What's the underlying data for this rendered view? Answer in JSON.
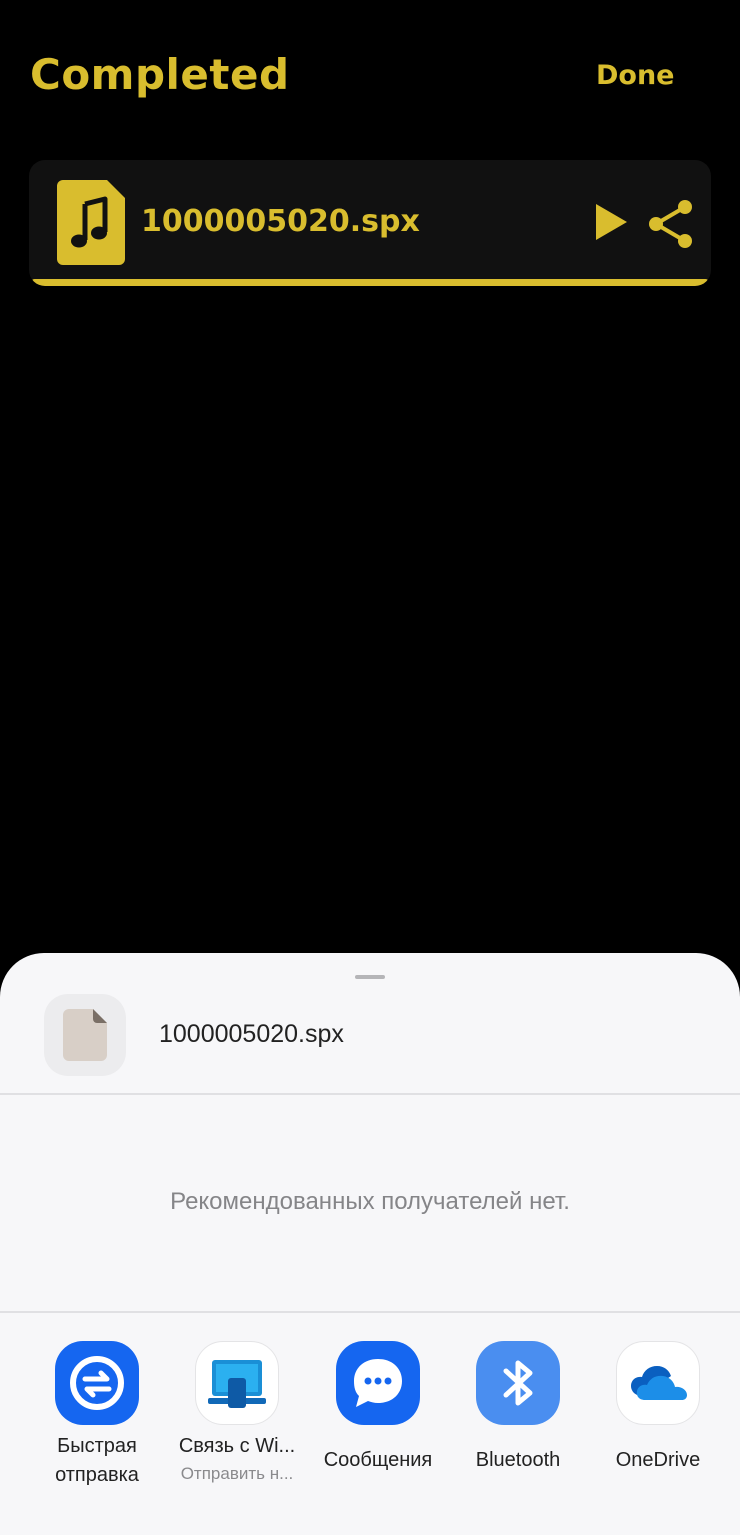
{
  "header": {
    "title": "Completed",
    "done_label": "Done"
  },
  "file": {
    "name": "1000005020.spx",
    "icon": "music-file-icon",
    "progress_percent": 100
  },
  "share_sheet": {
    "file_name": "1000005020.spx",
    "no_recipients_text": "Рекомендованных получателей нет.",
    "apps": [
      {
        "label_line1": "Быстрая",
        "label_line2": "отправка",
        "icon": "quick-share-icon"
      },
      {
        "label_line1": "Связь с Wi...",
        "sublabel": "Отправить н...",
        "icon": "link-to-windows-icon"
      },
      {
        "label_line1": "Сообщения",
        "icon": "messages-icon"
      },
      {
        "label_line1": "Bluetooth",
        "icon": "bluetooth-icon"
      },
      {
        "label_line1": "OneDrive",
        "icon": "onedrive-icon"
      }
    ]
  },
  "colors": {
    "accent": "#d9bd2e",
    "background": "#000000",
    "card": "#111111",
    "sheet": "#f7f7f9"
  }
}
